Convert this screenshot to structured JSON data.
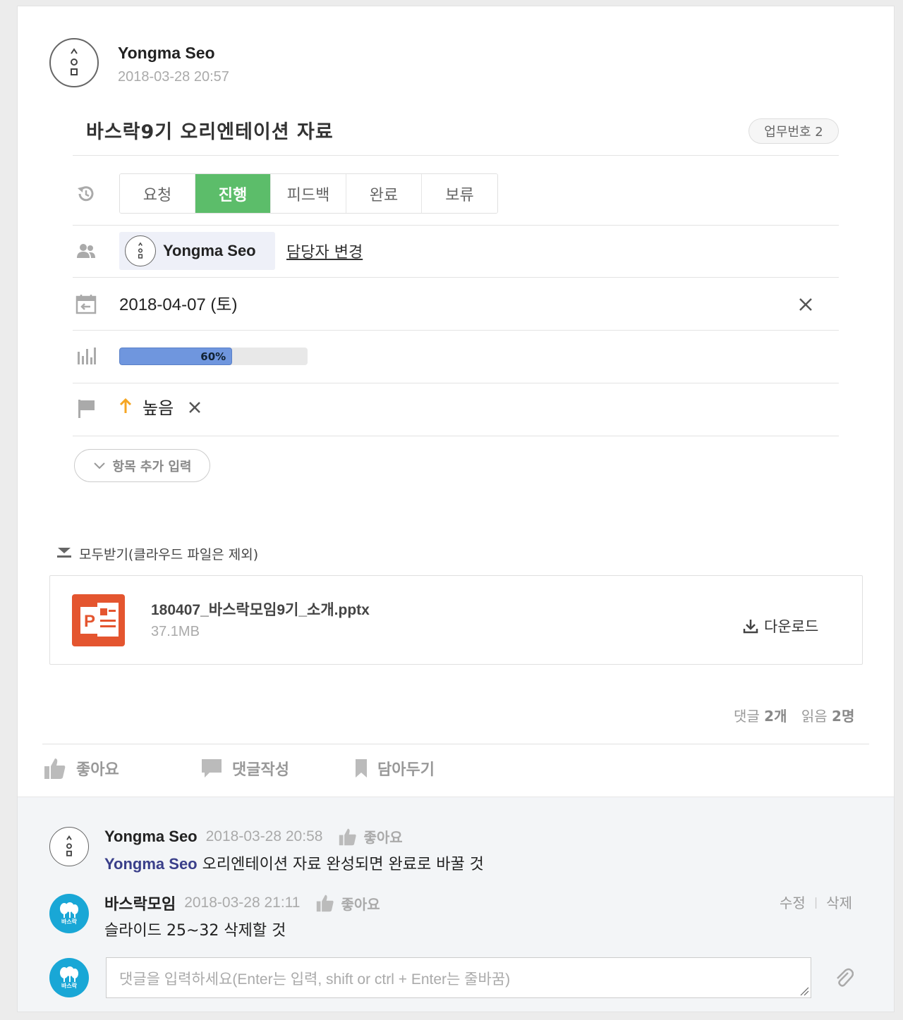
{
  "post": {
    "author": "Yongma Seo",
    "timestamp": "2018-03-28 20:57",
    "title": "바스락9기 오리엔테이션 자료",
    "task_number": "업무번호 2"
  },
  "status": {
    "options": [
      "요청",
      "진행",
      "피드백",
      "완료",
      "보류"
    ],
    "active": "진행"
  },
  "assignee": {
    "name": "Yongma Seo",
    "change_label": "담당자 변경"
  },
  "due_date": {
    "value": "2018-04-07 (토)"
  },
  "progress": {
    "percent": 60,
    "label": "60%"
  },
  "priority": {
    "label": "높음",
    "color": "#f5a623"
  },
  "add_field_label": "항목 추가 입력",
  "download_all_label": "모두받기(클라우드 파일은 제외)",
  "attachment": {
    "name": "180407_바스락모임9기_소개.pptx",
    "size": "37.1MB",
    "download_label": "다운로드",
    "icon": "powerpoint-icon"
  },
  "stats": {
    "comments_label": "댓글",
    "comments_count": "2개",
    "reads_label": "읽음",
    "reads_count": "2명"
  },
  "actions": {
    "like": "좋아요",
    "comment": "댓글작성",
    "bookmark": "담아두기"
  },
  "comments": [
    {
      "author": "Yongma Seo",
      "timestamp": "2018-03-28 20:58",
      "like_label": "좋아요",
      "mention": "Yongma Seo",
      "text": "오리엔테이션 자료 완성되면 완료로 바꿀 것"
    },
    {
      "author": "바스락모임",
      "timestamp": "2018-03-28 21:11",
      "like_label": "좋아요",
      "text": "슬라이드 25~32 삭제할 것",
      "edit_label": "수정",
      "delete_label": "삭제",
      "avatar_text": "바스락"
    }
  ],
  "comment_input": {
    "placeholder": "댓글을 입력하세요(Enter는 입력, shift or ctrl + Enter는 줄바꿈)",
    "avatar_text": "바스락"
  },
  "colors": {
    "active_status": "#5cbd6a",
    "progress": "#6f96de",
    "brand_avatar": "#19a7d6"
  }
}
